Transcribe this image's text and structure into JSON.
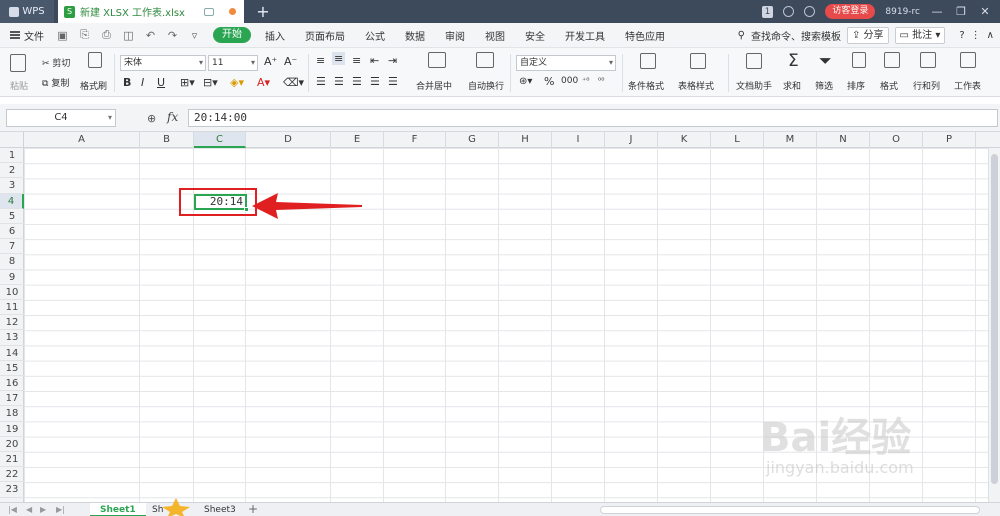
{
  "titlebar": {
    "app_label": "WPS",
    "doc_tab_title": "新建 XLSX 工作表.xlsx",
    "new_tab": "+",
    "notification_count": "1",
    "login_button": "访客登录",
    "user_label": "8919-rc"
  },
  "menu": {
    "file": "文件",
    "tabs": [
      "开始",
      "插入",
      "页面布局",
      "公式",
      "数据",
      "审阅",
      "视图",
      "安全",
      "开发工具",
      "特色应用"
    ],
    "search": "查找命令、搜索模板",
    "share": "分享",
    "comment": "批注",
    "help": "?"
  },
  "ribbon": {
    "paste": "粘贴",
    "cut": "剪切",
    "copy": "复制",
    "format_painter": "格式刷",
    "font_name": "宋体",
    "font_size": "11",
    "merge_center": "合并居中",
    "auto_wrap": "自动换行",
    "number_format": "自定义",
    "conditional_format": "条件格式",
    "table_style": "表格样式",
    "doc_helper": "文档助手",
    "sum": "求和",
    "filter": "筛选",
    "sort": "排序",
    "format": "格式",
    "rows_cols": "行和列",
    "worksheet": "工作表"
  },
  "formula_bar": {
    "name_box": "C4",
    "fx": "fx",
    "value": "20:14:00"
  },
  "grid": {
    "columns": [
      "A",
      "B",
      "C",
      "D",
      "E",
      "F",
      "G",
      "H",
      "I",
      "J",
      "K",
      "L",
      "M",
      "N",
      "O",
      "P"
    ],
    "rows": [
      "1",
      "2",
      "3",
      "4",
      "5",
      "6",
      "7",
      "8",
      "9",
      "10",
      "11",
      "12",
      "13",
      "14",
      "15",
      "16",
      "17",
      "18",
      "19",
      "20",
      "21",
      "22",
      "23"
    ],
    "selected_column": "C",
    "selected_row": "4",
    "active_cell_display": "20:14"
  },
  "sheets": {
    "tabs": [
      "Sheet1",
      "Sh",
      "Sheet3"
    ],
    "active": "Sheet1"
  },
  "watermark": {
    "brand": "Bai经验",
    "url": "jingyan.baidu.com"
  },
  "colors": {
    "accent_green": "#2aa653",
    "highlight_red": "#e02020",
    "titlebar_bg": "#3d4a5c"
  }
}
